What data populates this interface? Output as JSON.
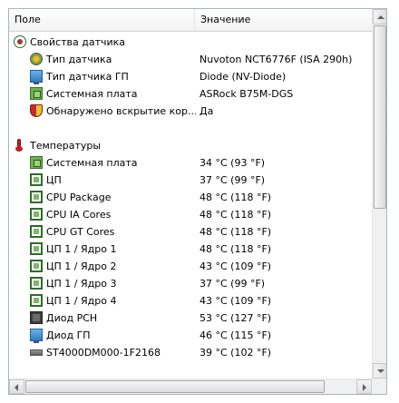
{
  "header": {
    "col_field": "Поле",
    "col_value": "Значение"
  },
  "sensor_group": {
    "title": "Свойства датчика",
    "items": [
      {
        "label": "Тип датчика",
        "value": "Nuvoton NCT6776F  (ISA 290h)",
        "icon": "sensor-icon"
      },
      {
        "label": "Тип датчика ГП",
        "value": "Diode  (NV-Diode)",
        "icon": "gpu-icon"
      },
      {
        "label": "Системная плата",
        "value": "ASRock B75M-DGS",
        "icon": "motherboard-icon"
      },
      {
        "label": "Обнаружено вскрытие кор...",
        "value": "Да",
        "icon": "shield-icon"
      }
    ]
  },
  "temp_group": {
    "title": "Температуры",
    "items": [
      {
        "label": "Системная плата",
        "value": "34 °C  (93 °F)",
        "icon": "motherboard-icon"
      },
      {
        "label": "ЦП",
        "value": "37 °C  (99 °F)",
        "icon": "cpu-icon"
      },
      {
        "label": "CPU Package",
        "value": "48 °C  (118 °F)",
        "icon": "cpu-icon"
      },
      {
        "label": "CPU IA Cores",
        "value": "48 °C  (118 °F)",
        "icon": "cpu-icon"
      },
      {
        "label": "CPU GT Cores",
        "value": "48 °C  (118 °F)",
        "icon": "cpu-icon"
      },
      {
        "label": "ЦП 1 / Ядро 1",
        "value": "48 °C  (118 °F)",
        "icon": "cpu-icon"
      },
      {
        "label": "ЦП 1 / Ядро 2",
        "value": "43 °C  (109 °F)",
        "icon": "cpu-icon"
      },
      {
        "label": "ЦП 1 / Ядро 3",
        "value": "37 °C  (99 °F)",
        "icon": "cpu-icon"
      },
      {
        "label": "ЦП 1 / Ядро 4",
        "value": "43 °C  (109 °F)",
        "icon": "cpu-icon"
      },
      {
        "label": "Диод PCH",
        "value": "53 °C  (127 °F)",
        "icon": "chip-icon"
      },
      {
        "label": "Диод ГП",
        "value": "46 °C  (115 °F)",
        "icon": "gpu-icon"
      },
      {
        "label": "ST4000DM000-1F2168",
        "value": "39 °C  (102 °F)",
        "icon": "hdd-icon"
      }
    ]
  }
}
